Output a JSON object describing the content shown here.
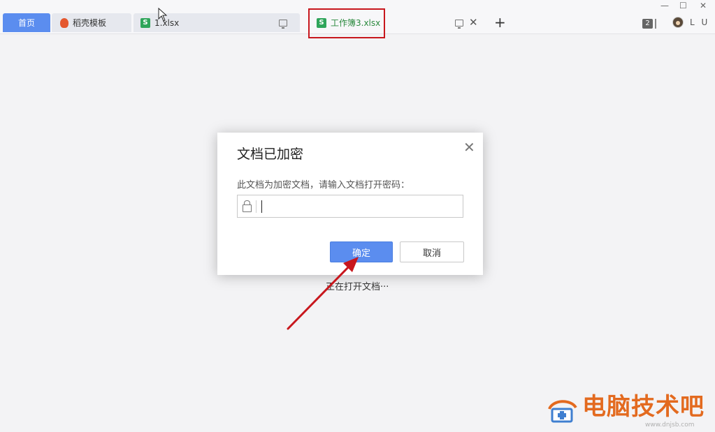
{
  "tabs": {
    "home": "首页",
    "template": "稻壳模板",
    "file1": "1.xlsx",
    "active": "工作簿3.xlsx",
    "sheet_icon_letter": "S"
  },
  "toolbar": {
    "new_tab": "+",
    "window_count": "2",
    "user_name": "L U"
  },
  "dialog": {
    "title": "文档已加密",
    "message": "此文档为加密文档，请输入文档打开密码：",
    "password_value": "",
    "ok_label": "确定",
    "cancel_label": "取消"
  },
  "status": {
    "opening": "正在打开文档···"
  },
  "watermark": {
    "brand": "电脑技术吧",
    "domain": "www.dnjsb.com"
  },
  "colors": {
    "accent": "#5b8def",
    "sheet_green": "#2fa55a",
    "highlight_red": "#c8171d",
    "watermark_orange": "#e36a1f"
  }
}
